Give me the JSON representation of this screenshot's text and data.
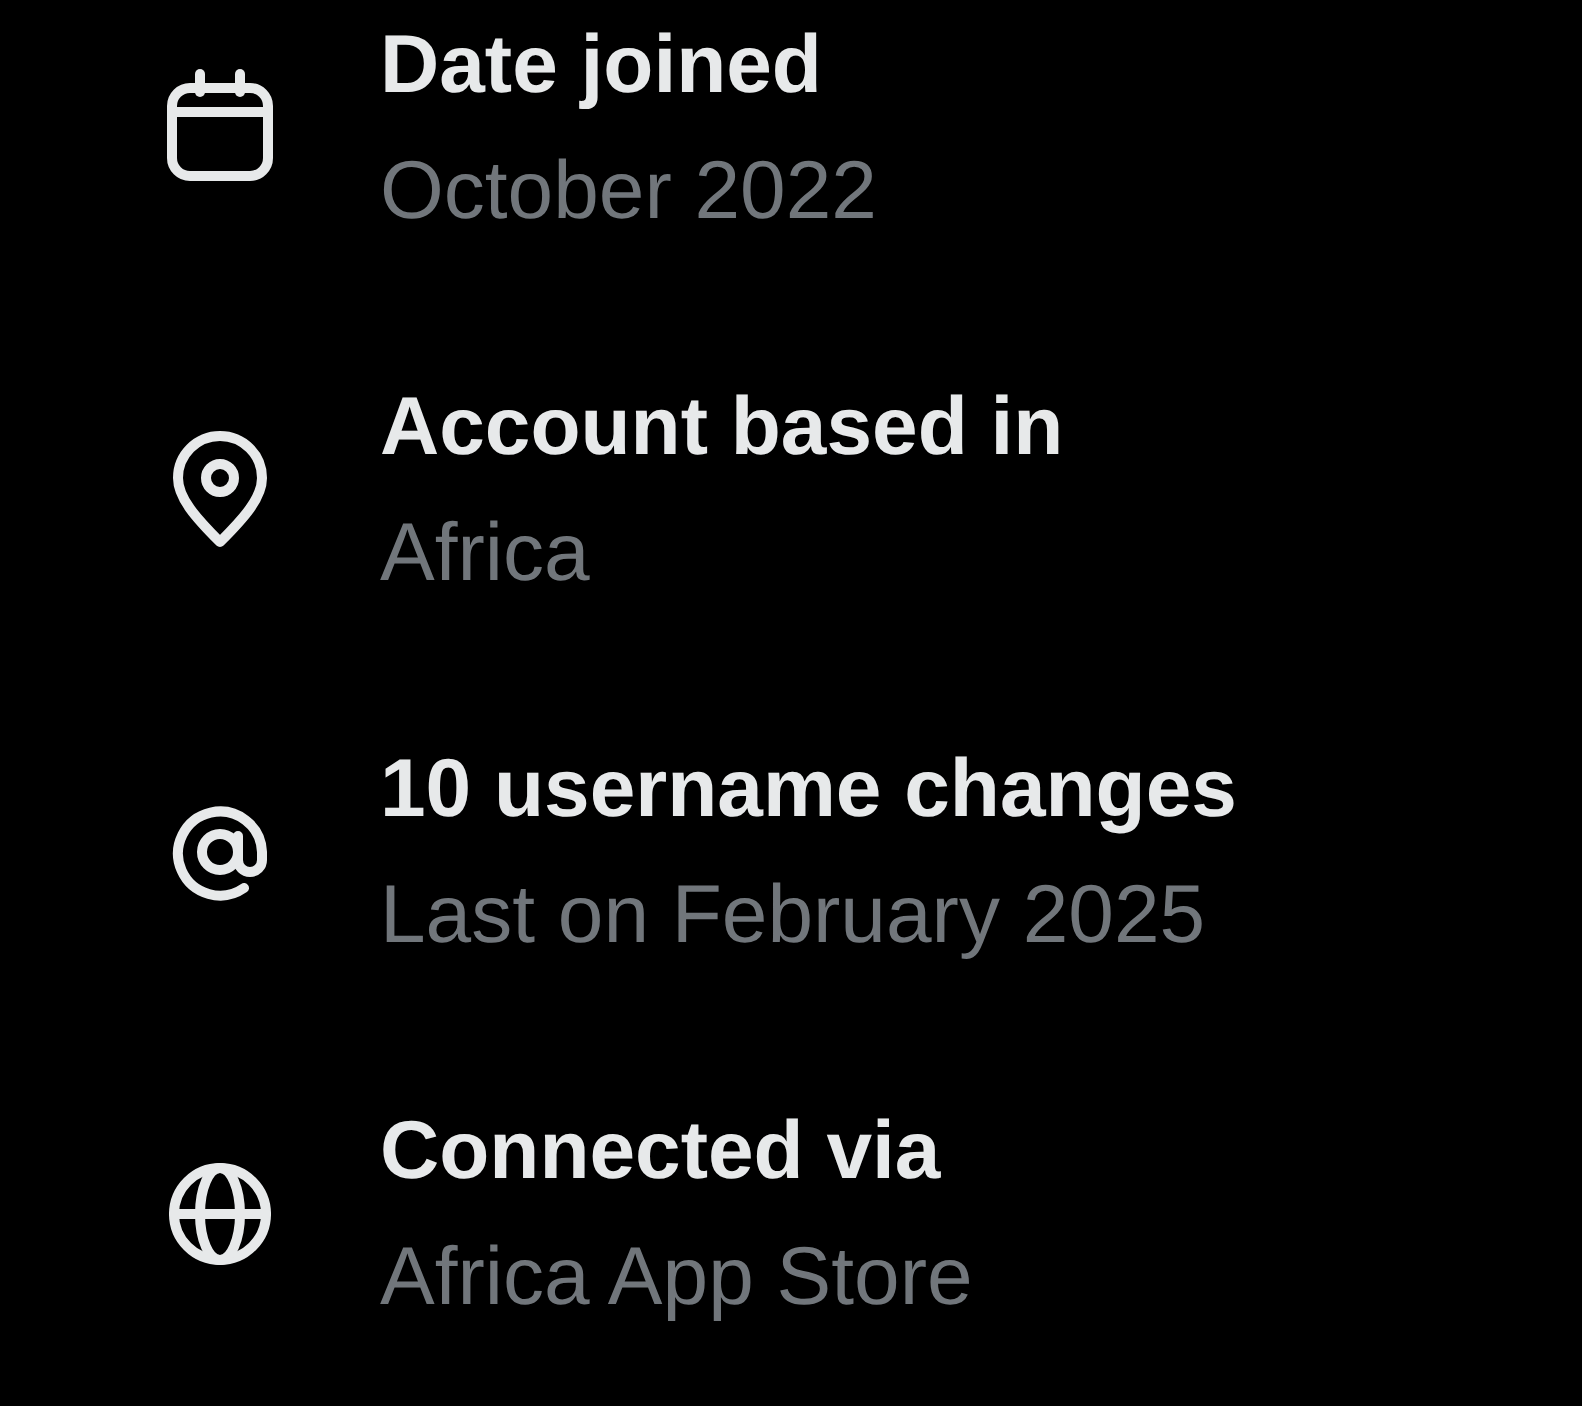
{
  "rows": [
    {
      "kind": "calendar",
      "title": "Date joined",
      "detail": "October 2022"
    },
    {
      "kind": "location",
      "title": "Account based in",
      "detail": "Africa"
    },
    {
      "kind": "at",
      "title": "10 username changes",
      "detail": "Last on February 2025"
    },
    {
      "kind": "globe",
      "title": "Connected via",
      "detail": "Africa App Store"
    }
  ]
}
